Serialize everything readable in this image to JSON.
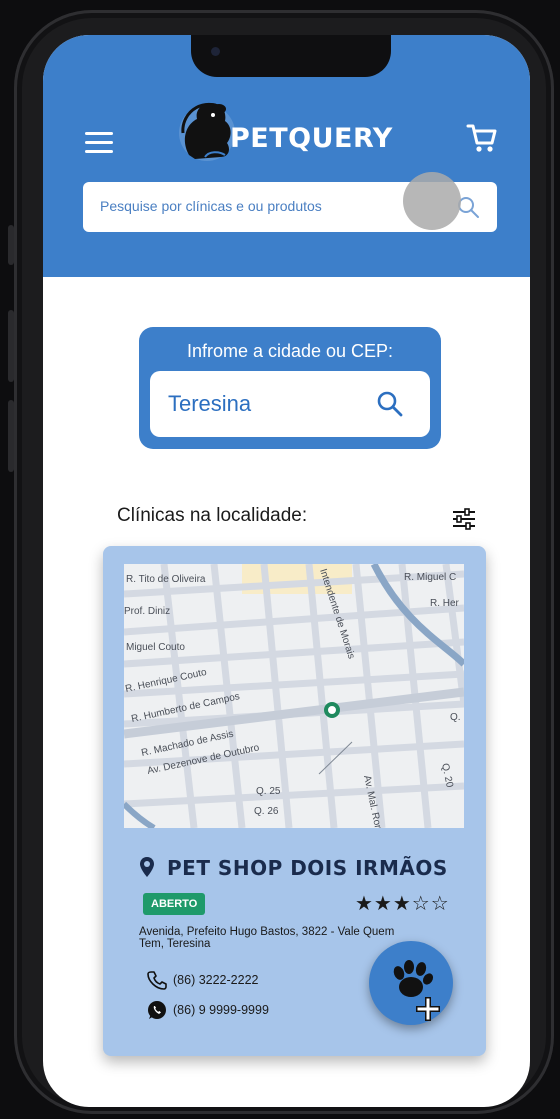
{
  "app": {
    "name": "PETQUERY"
  },
  "search": {
    "placeholder": "Pesquise por clínicas e ou produtos"
  },
  "location": {
    "prompt": "Infrome a cidade ou CEP:",
    "value": "Teresina"
  },
  "results": {
    "title": "Clínicas na localidade:"
  },
  "map_labels": [
    "R. Tito de Oliveira",
    "R. Miguel C",
    "R. Her",
    "Prof. Diniz",
    "Miguel Couto",
    "R. Henrique Couto",
    "R. Humberto de Campos",
    "R. Machado de Assis",
    "Av. Dezenove de Outubro",
    "Intendente de Morais",
    "Av. Mal. Rondon",
    "Q. 25",
    "Q. 26",
    "Q. 20",
    "Q."
  ],
  "clinic": {
    "name": "PET SHOP DOIS IRMÃOS",
    "status": "ABERTO",
    "rating": 3,
    "rating_max": 5,
    "stars_text": "★★★☆☆",
    "address": "Avenida, Prefeito Hugo Bastos, 3822 - Vale Quem Tem, Teresina",
    "phone": "(86) 3222-2222",
    "whatsapp": "(86) 9 9999-9999"
  },
  "colors": {
    "primary": "#3d7fca",
    "card": "#a7c5ea",
    "status_open": "#1f9a6a",
    "map_pin": "#1f8a5e"
  },
  "icons": {
    "menu": "hamburger-menu-icon",
    "cart": "shopping-cart-icon",
    "search": "search-icon",
    "filter": "sliders-filter-icon",
    "pin": "map-pin-icon",
    "phone": "phone-icon",
    "whatsapp": "whatsapp-icon",
    "fab": "paw-plus-icon"
  }
}
